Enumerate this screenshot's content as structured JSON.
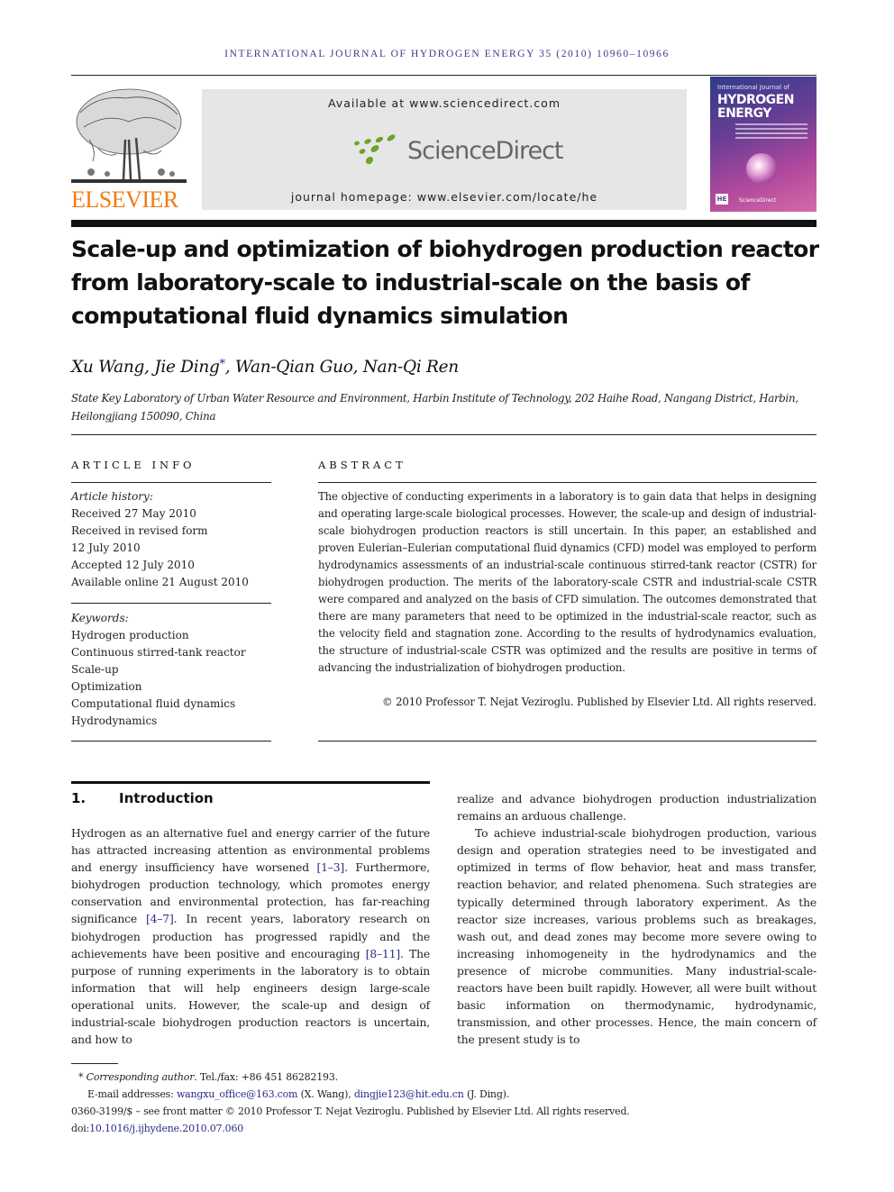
{
  "running_head": "INTERNATIONAL JOURNAL OF HYDROGEN ENERGY 35 (2010) 10960–10966",
  "publisher": {
    "logo_text": "ELSEVIER",
    "brand_color": "#f07b14"
  },
  "sciencedirect": {
    "available_at": "Available at www.sciencedirect.com",
    "logo_text": "ScienceDirect",
    "homepage": "journal homepage: www.elsevier.com/locate/he",
    "dot_color": "#6aa42a"
  },
  "cover": {
    "line1": "International Journal of",
    "line2": "HYDROGEN",
    "line3": "ENERGY",
    "sd_label": "ScienceDirect",
    "badge": "HE"
  },
  "article": {
    "title": "Scale-up and optimization of biohydrogen production reactor from laboratory-scale to industrial-scale on the basis of computational fluid dynamics simulation",
    "authors_before_star": "Xu Wang, Jie Ding",
    "author_star": "*",
    "authors_after_star": ", Wan-Qian Guo, Nan-Qi Ren",
    "affiliation": "State Key Laboratory of Urban Water Resource and Environment, Harbin Institute of Technology, 202 Haihe Road, Nangang District, Harbin, Heilongjiang 150090, China"
  },
  "article_info": {
    "heading": "ARTICLE INFO",
    "history_label": "Article history:",
    "history": [
      "Received 27 May 2010",
      "Received in revised form",
      "12 July 2010",
      "Accepted 12 July 2010",
      "Available online 21 August 2010"
    ],
    "keywords_label": "Keywords:",
    "keywords": [
      "Hydrogen production",
      "Continuous stirred-tank reactor",
      "Scale-up",
      "Optimization",
      "Computational fluid dynamics",
      "Hydrodynamics"
    ]
  },
  "abstract": {
    "heading": "ABSTRACT",
    "text": "The objective of conducting experiments in a laboratory is to gain data that helps in designing and operating large-scale biological processes. However, the scale-up and design of industrial-scale biohydrogen production reactors is still uncertain. In this paper, an established and proven Eulerian–Eulerian computational fluid dynamics (CFD) model was employed to perform hydrodynamics assessments of an industrial-scale continuous stirred-tank reactor (CSTR) for biohydrogen production. The merits of the laboratory-scale CSTR and industrial-scale CSTR were compared and analyzed on the basis of CFD simulation. The outcomes demonstrated that there are many parameters that need to be optimized in the industrial-scale reactor, such as the velocity field and stagnation zone. According to the results of hydrodynamics evaluation, the structure of industrial-scale CSTR was optimized and the results are positive in terms of advancing the industrialization of biohydrogen production.",
    "copyright": "© 2010 Professor T. Nejat Veziroglu. Published by Elsevier Ltd. All rights reserved."
  },
  "introduction": {
    "number": "1.",
    "heading": "Introduction",
    "left": {
      "p1_a": "Hydrogen as an alternative fuel and energy carrier of the future has attracted increasing attention as environmental problems and energy insufficiency have worsened ",
      "ref1": "[1–3]",
      "p1_b": ". Furthermore, biohydrogen production technology, which promotes energy conservation and environmental protection, has far-reaching significance ",
      "ref2": "[4–7]",
      "p1_c": ". In recent years, laboratory research on biohydrogen production has progressed rapidly and the achievements have been positive and encouraging ",
      "ref3": "[8–11]",
      "p1_d": ". The purpose of running experiments in the laboratory is to obtain information that will help engineers design large-scale operational units. However, the scale-up and design of industrial-scale biohydrogen production reactors is uncertain, and how to"
    },
    "right": {
      "p1": "realize and advance biohydrogen production industrialization remains an arduous challenge.",
      "p2": "To achieve industrial-scale biohydrogen production, various design and operation strategies need to be investigated and optimized in terms of flow behavior, heat and mass transfer, reaction behavior, and related phenomena. Such strategies are typically determined through laboratory experiment. As the reactor size increases, various problems such as breakages, wash out, and dead zones may become more severe owing to increasing inhomogeneity in the hydrodynamics and the presence of microbe communities. Many industrial-scale-reactors have been built rapidly. However, all were built without basic information on thermodynamic, hydrodynamic, transmission, and other processes. Hence, the main concern of the present study is to"
    }
  },
  "footnotes": {
    "star": "*",
    "corresponding_label": "Corresponding author",
    "corresponding_rest": ". Tel./fax: +86 451 86282193.",
    "email_label": "E-mail addresses: ",
    "email1": "wangxu_office@163.com",
    "email1_owner": " (X. Wang), ",
    "email2": "dingjie123@hit.edu.cn",
    "email2_owner": " (J. Ding).",
    "issn_line": "0360-3199/$ – see front matter © 2010 Professor T. Nejat Veziroglu. Published by Elsevier Ltd. All rights reserved.",
    "doi_prefix": "doi:",
    "doi": "10.1016/j.ijhydene.2010.07.060"
  },
  "colors": {
    "link": "#2a2a8c",
    "running_head": "#3b3b8c",
    "banner_bg": "#e6e6e6"
  }
}
